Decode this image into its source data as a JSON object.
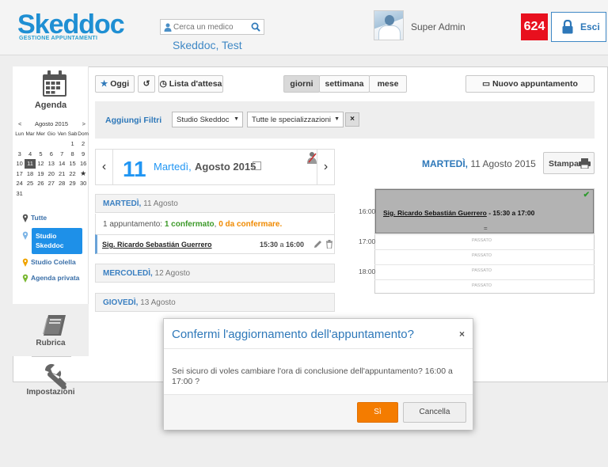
{
  "header": {
    "logo_main": "Skeddoc",
    "logo_sub": "GESTIONE APPUNTAMENTI",
    "search_placeholder": "Cerca un medico",
    "clinic_name": "Skeddoc, Test",
    "username": "Super Admin",
    "badge_count": "624",
    "logout_label": "Esci"
  },
  "sidebar": {
    "agenda_label": "Agenda",
    "calendar": {
      "prev": "<",
      "next": ">",
      "month_year": "Agosto 2015",
      "weekdays": [
        "Lun",
        "Mar",
        "Mer",
        "Gio",
        "Ven",
        "Sab",
        "Dom"
      ],
      "weeks": [
        [
          "",
          "",
          "",
          "",
          "",
          "1",
          "2"
        ],
        [
          "3",
          "4",
          "5",
          "6",
          "7",
          "8",
          "9"
        ],
        [
          "10",
          "11",
          "12",
          "13",
          "14",
          "15",
          "16"
        ],
        [
          "17",
          "18",
          "19",
          "20",
          "21",
          "22",
          "★"
        ],
        [
          "24",
          "25",
          "26",
          "27",
          "28",
          "29",
          "30"
        ],
        [
          "31",
          "",
          "",
          "",
          "",
          "",
          ""
        ]
      ],
      "selected_day": "11"
    },
    "studios": {
      "all": "Tutte",
      "active_line1": "Studio",
      "active_line2": "Skeddoc",
      "colella": "Studio Colella",
      "privata": "Agenda privata"
    },
    "rubrica_label": "Rubrica",
    "impostazioni_label": "Impostazioni"
  },
  "toolbar": {
    "oggi": "Oggi",
    "lista": "Lista d'attesa",
    "giorni": "giorni",
    "settimana": "settimana",
    "mese": "mese",
    "nuovo": "Nuovo appuntamento"
  },
  "filters": {
    "label": "Aggiungi Filtri",
    "studio_value": "Studio Skeddoc",
    "spec_value": "Tutte le specializzazioni",
    "clear": "×"
  },
  "datenav": {
    "day": "11",
    "weekday": "Martedì,",
    "month_year": "Agosto 2015"
  },
  "list": {
    "day1_name": "MARTEDÌ,",
    "day1_date": " 11 Agosto",
    "summary_prefix": "1 appuntamento: ",
    "summary_confirmed": "1 confermato",
    "summary_sep": ", ",
    "summary_pending": "0 da confermare.",
    "appt_patient": "Sig. Ricardo Sebastián Guerrero",
    "appt_start": "15:30",
    "appt_a": " a ",
    "appt_end": "16:00",
    "day2_name": "MERCOLEDÌ,",
    "day2_date": " 12 Agosto",
    "day3_name": "GIOVEDÌ,",
    "day3_date": " 13 Agosto"
  },
  "dayview": {
    "title_day": "MARTEDÌ,",
    "title_date": " 11 Agosto 2015",
    "print_label": "Stampa",
    "hours": [
      "16:00",
      "17:00",
      "18:00"
    ],
    "event_patient": "Sig. Ricardo Sebastián Guerrero",
    "event_time": " - 15:30 a 17:00",
    "event_check": "✔",
    "past_label": "PASSATO"
  },
  "modal": {
    "title": "Confermi l'aggiornamento dell'appuntamento?",
    "close": "×",
    "body": "Sei sicuro di voles cambiare l'ora di conclusione dell'appuntamento? 16:00 a 17:00 ?",
    "confirm": "Sì",
    "cancel": "Cancella"
  }
}
